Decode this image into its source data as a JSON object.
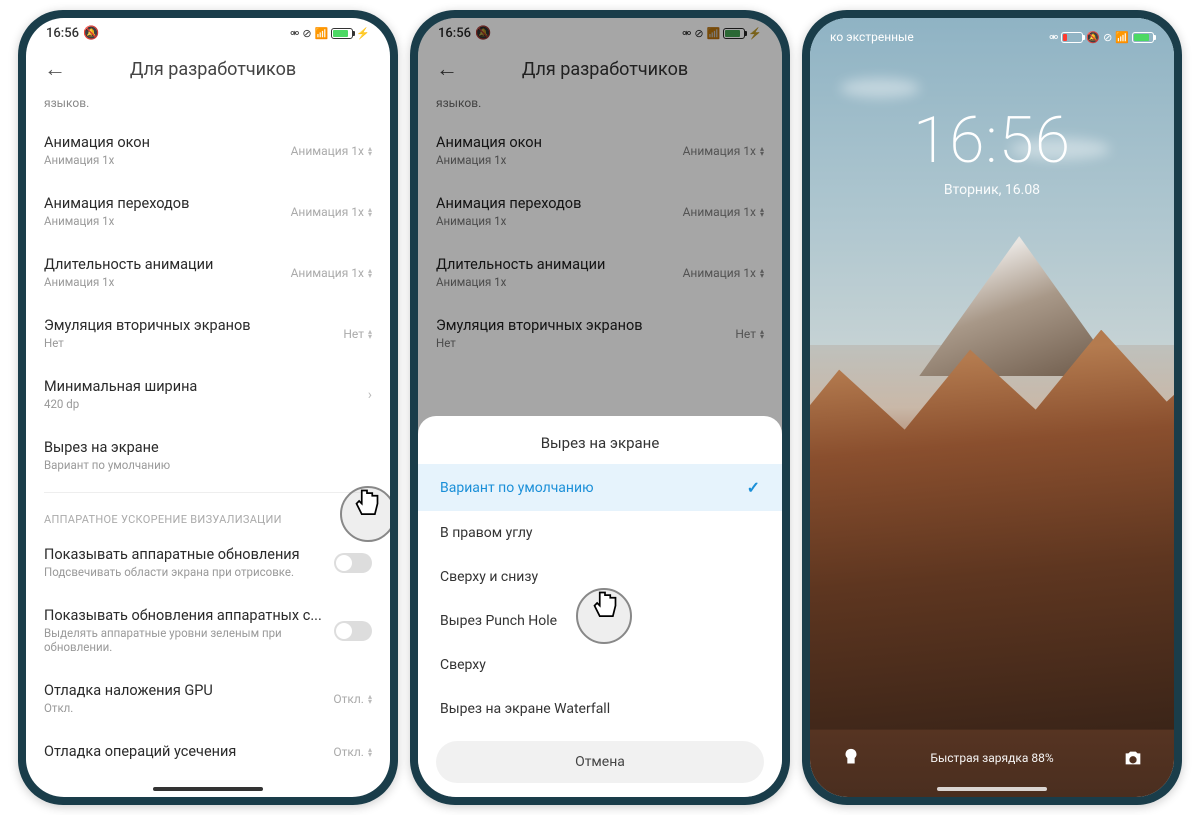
{
  "status": {
    "time": "16:56",
    "bell_icon": "🔕",
    "icons": "⚙ ⊗ ⚡ 📶"
  },
  "header": {
    "title": "Для разработчиков",
    "back": "←"
  },
  "truncated": "языков.",
  "settings": [
    {
      "title": "Анимация окон",
      "sub": "Анимация 1x",
      "value": "Анимация 1x",
      "kind": "updown"
    },
    {
      "title": "Анимация переходов",
      "sub": "Анимация 1x",
      "value": "Анимация 1x",
      "kind": "updown"
    },
    {
      "title": "Длительность анимации",
      "sub": "Анимация 1x",
      "value": "Анимация 1x",
      "kind": "updown"
    },
    {
      "title": "Эмуляция вторичных экранов",
      "sub": "Нет",
      "value": "Нет",
      "kind": "updown"
    },
    {
      "title": "Минимальная ширина",
      "sub": "420 dp",
      "value": "",
      "kind": "chevron"
    },
    {
      "title": "Вырез на экране",
      "sub": "Вариант по умолчанию",
      "value": "",
      "kind": "none"
    }
  ],
  "section_header": "АППАРАТНОЕ УСКОРЕНИЕ ВИЗУАЛИЗАЦИИ",
  "hw_settings": [
    {
      "title": "Показывать аппаратные обновления",
      "sub": "Подсвечивать области экрана при отрисовке.",
      "kind": "toggle"
    },
    {
      "title": "Показывать обновления аппаратных с...",
      "sub": "Выделять аппаратные уровни зеленым при обновлении.",
      "kind": "toggle"
    },
    {
      "title": "Отладка наложения GPU",
      "sub": "Откл.",
      "value": "Откл.",
      "kind": "updown"
    },
    {
      "title": "Отладка операций усечения",
      "sub": "",
      "value": "Откл.",
      "kind": "updown"
    }
  ],
  "sheet": {
    "title": "Вырез на экране",
    "options": [
      {
        "label": "Вариант по умолчанию",
        "selected": true
      },
      {
        "label": "В правом углу",
        "selected": false
      },
      {
        "label": "Сверху и снизу",
        "selected": false
      },
      {
        "label": "Вырез Punch Hole",
        "selected": false
      },
      {
        "label": "Сверху",
        "selected": false
      },
      {
        "label": "Вырез на экране Waterfall",
        "selected": false
      }
    ],
    "cancel": "Отмена"
  },
  "lockscreen": {
    "emergency": "ко экстренные",
    "clock": "16:56",
    "date": "Вторник, 16.08",
    "charge": "Быстрая зарядка 88%"
  }
}
